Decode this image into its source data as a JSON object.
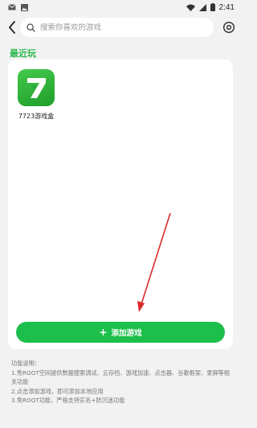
{
  "status_bar": {
    "time": "2:41"
  },
  "search": {
    "placeholder": "搜索你喜欢的游戏"
  },
  "section": {
    "title": "最近玩"
  },
  "games": [
    {
      "label": "7723游戏盒",
      "icon": "7723-app-icon"
    }
  ],
  "add_button": {
    "icon": "+",
    "label": "添加游戏"
  },
  "description": {
    "heading": "功能说明：",
    "line1": "1.免ROOT空间提供数据搜索调试、云存档、游戏加速、点击器、谷歌框架、录屏等相关功能",
    "line2": "2.点击添加游戏，即可添加本地应用",
    "line3": "3.免ROOT功能，严格支持实名+防沉迷功能"
  },
  "colors": {
    "accent_green": "#1dbf4c",
    "section_title_green": "#2bb84d",
    "annotation_red": "#d92b2b"
  }
}
